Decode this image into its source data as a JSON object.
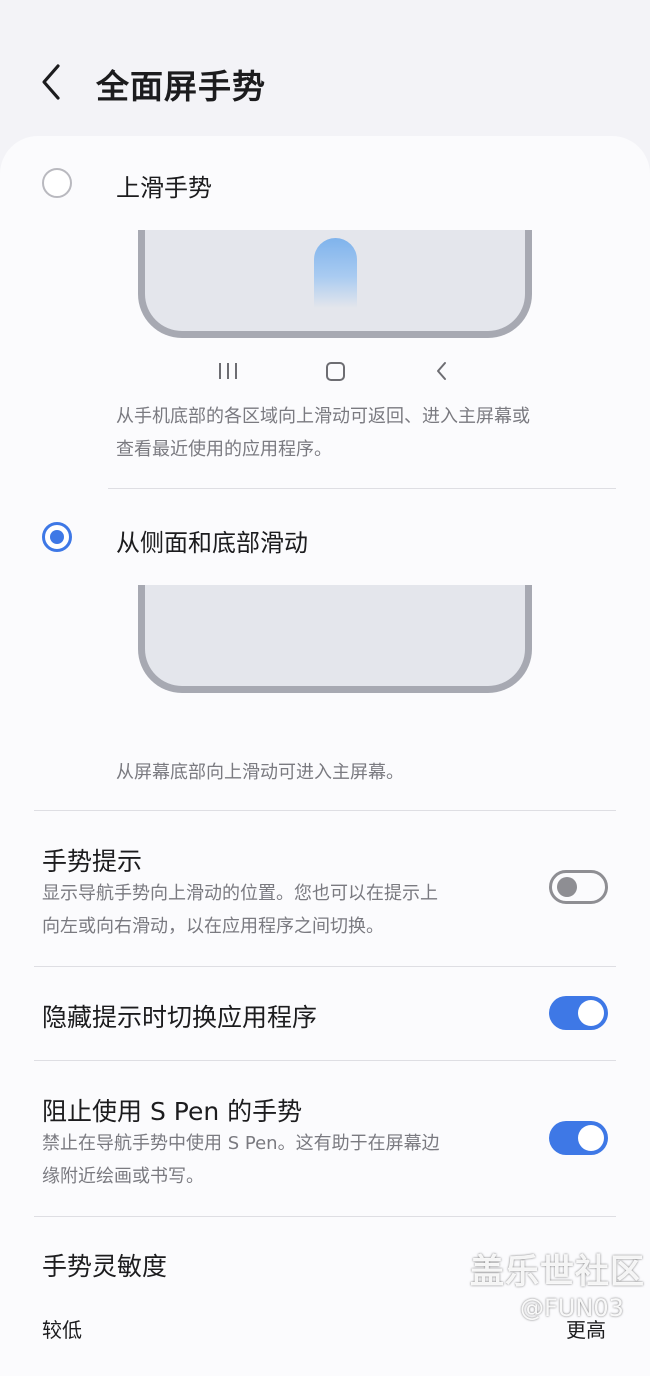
{
  "header": {
    "title": "全面屏手势"
  },
  "options": [
    {
      "label": "上滑手势",
      "selected": false,
      "description_lines": [
        "从手机底部的各区域向上滑动可返回、进入主屏幕或",
        "查看最近使用的应用程序。"
      ]
    },
    {
      "label": "从侧面和底部滑动",
      "selected": true,
      "description_lines": [
        "从屏幕底部向上滑动可进入主屏幕。"
      ]
    }
  ],
  "preview_nav_icons": [
    "recents-icon",
    "home-icon",
    "back-icon"
  ],
  "settings": {
    "gesture_hint": {
      "title": "手势提示",
      "description_lines": [
        "显示导航手势向上滑动的位置。您也可以在提示上",
        "向左或向右滑动，以在应用程序之间切换。"
      ],
      "enabled": false
    },
    "switch_apps_hidden": {
      "title": "隐藏提示时切换应用程序",
      "enabled": true
    },
    "block_spen": {
      "title": "阻止使用 S Pen 的手势",
      "description_lines": [
        "禁止在导航手势中使用 S Pen。这有助于在屏幕边",
        "缘附近绘画或书写。"
      ],
      "enabled": true
    },
    "sensitivity": {
      "title": "手势灵敏度",
      "low_label": "较低",
      "high_label": "更高"
    }
  },
  "watermark": {
    "main": "盖乐世社区",
    "sub": "@FUN03"
  },
  "colors": {
    "accent": "#3e78e6",
    "background": "#f3f3f7",
    "card": "#fbfbfd",
    "frame": "#a7a9b2"
  }
}
